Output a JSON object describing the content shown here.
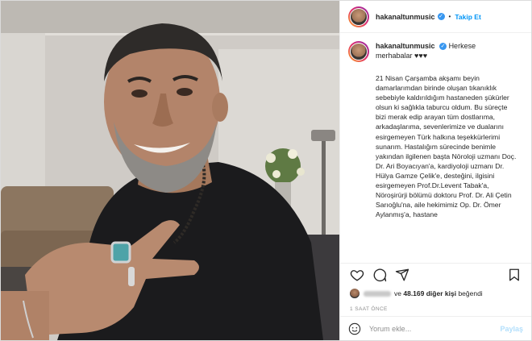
{
  "header": {
    "username": "hakanaltunmusic",
    "verified_icon": "verified-badge-icon",
    "separator": "•",
    "follow_label": "Takip Et"
  },
  "caption": {
    "username": "hakanaltunmusic",
    "greeting": "Herkese merhabalar ♥♥♥",
    "body": "21 Nisan Çarşamba akşamı beyin damarlarımdan birinde oluşan tıkanıklık sebebiyle kaldırıldığım hastaneden şükürler olsun ki sağlıkla taburcu oldum. Bu süreçte bizi merak edip arayan tüm dostlarıma, arkadaşlarıma, sevenlerimize ve dualarını esirgemeyen Türk halkına teşekkürlerimi sunarım. Hastalığım sürecinde benimle yakından ilgilenen başta Nöroloji uzmanı Doç. Dr. Ari Boyacıyan'a, kardiyoloji uzmanı Dr. Hülya Gamze Çelik'e, desteğini, ilgisini esirgemeyen Prof.Dr.Levent Tabak'a, Nöroşirürji bölümü doktoru Prof. Dr. Ali Çetin Sarıoğlu'na, aile hekimimiz Op. Dr. Ömer Aylanmış'a, hastane"
  },
  "actions": {
    "like_icon": "heart-icon",
    "comment_icon": "comment-icon",
    "share_icon": "share-icon",
    "save_icon": "bookmark-icon"
  },
  "likes": {
    "connector": "ve",
    "count": "48.169",
    "suffix": "diğer kişi",
    "verb": "beğendi"
  },
  "timestamp": "1 SAAT ÖNCE",
  "comment_box": {
    "placeholder": "Yorum ekle...",
    "post_label": "Paylaş"
  },
  "colors": {
    "accent": "#0095f6",
    "post_disabled": "#b2dffc",
    "verified": "#3897f0"
  }
}
